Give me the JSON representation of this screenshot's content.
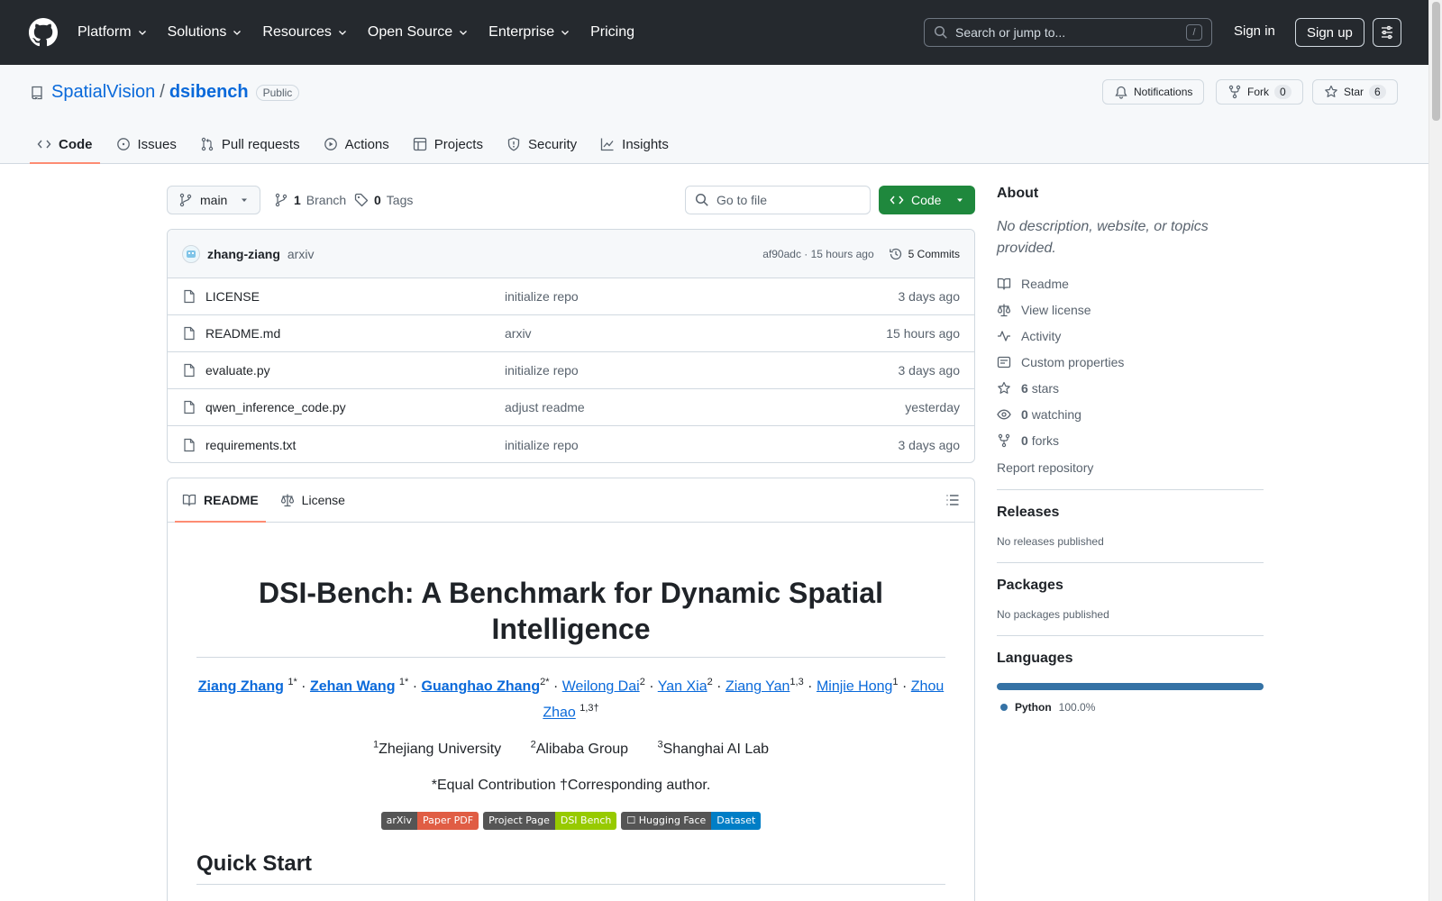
{
  "header": {
    "nav": [
      "Platform",
      "Solutions",
      "Resources",
      "Open Source",
      "Enterprise",
      "Pricing"
    ],
    "search_placeholder": "Search or jump to...",
    "search_key": "/",
    "sign_in": "Sign in",
    "sign_up": "Sign up"
  },
  "repo": {
    "owner": "SpatialVision",
    "separator": "/",
    "name": "dsibench",
    "visibility": "Public",
    "notifications": "Notifications",
    "fork": "Fork",
    "fork_count": "0",
    "star": "Star",
    "star_count": "6"
  },
  "tabs": [
    "Code",
    "Issues",
    "Pull requests",
    "Actions",
    "Projects",
    "Security",
    "Insights"
  ],
  "file_nav": {
    "branch": "main",
    "branch_count": "1",
    "branch_label": "Branch",
    "tag_count": "0",
    "tag_label": "Tags",
    "go_to_file": "Go to file",
    "code_button": "Code"
  },
  "latest_commit": {
    "author": "zhang-ziang",
    "message": "arxiv",
    "hash_time": "af90adc · 15 hours ago",
    "commits": "5 Commits"
  },
  "files": [
    {
      "name": "LICENSE",
      "message": "initialize repo",
      "date": "3 days ago"
    },
    {
      "name": "README.md",
      "message": "arxiv",
      "date": "15 hours ago"
    },
    {
      "name": "evaluate.py",
      "message": "initialize repo",
      "date": "3 days ago"
    },
    {
      "name": "qwen_inference_code.py",
      "message": "adjust readme",
      "date": "yesterday"
    },
    {
      "name": "requirements.txt",
      "message": "initialize repo",
      "date": "3 days ago"
    }
  ],
  "readme": {
    "tabs": [
      "README",
      "License"
    ],
    "title": "DSI-Bench: A Benchmark for Dynamic Spatial Intelligence",
    "authors": [
      {
        "name": "Ziang Zhang",
        "sup": "1*",
        "bold": true
      },
      {
        "name": "Zehan Wang",
        "sup": "1*",
        "bold": true
      },
      {
        "name": "Guanghao Zhang",
        "sup": "2*",
        "bold": true
      },
      {
        "name": "Weilong Dai",
        "sup": "2",
        "bold": false
      },
      {
        "name": "Yan Xia",
        "sup": "2",
        "bold": false
      },
      {
        "name": "Ziang Yan",
        "sup": "1,3",
        "bold": false
      },
      {
        "name": "Minjie Hong",
        "sup": "1",
        "bold": false
      },
      {
        "name": "Zhou Zhao",
        "sup": "1,3†",
        "bold": false
      }
    ],
    "affiliations": [
      {
        "sup": "1",
        "name": "Zhejiang University"
      },
      {
        "sup": "2",
        "name": "Alibaba Group"
      },
      {
        "sup": "3",
        "name": "Shanghai AI Lab"
      }
    ],
    "note": "*Equal Contribution †Corresponding author.",
    "badges": [
      {
        "left": "arXiv",
        "right": "Paper PDF",
        "color": "#e05d44"
      },
      {
        "left": "Project Page",
        "right": "DSI Bench",
        "color": "#97ca00"
      },
      {
        "left": "☐ Hugging Face",
        "right": "Dataset",
        "color": "#007ec6"
      }
    ],
    "section": "Quick Start"
  },
  "about": {
    "title": "About",
    "description": "No description, website, or topics provided.",
    "links": [
      {
        "icon": "book-icon",
        "count": "",
        "label": "Readme"
      },
      {
        "icon": "law-icon",
        "count": "",
        "label": "View license"
      },
      {
        "icon": "pulse-icon",
        "count": "",
        "label": "Activity"
      },
      {
        "icon": "note-icon",
        "count": "",
        "label": "Custom properties"
      },
      {
        "icon": "star-icon",
        "count": "6",
        "label": "stars"
      },
      {
        "icon": "eye-icon",
        "count": "0",
        "label": "watching"
      },
      {
        "icon": "fork-icon",
        "count": "0",
        "label": "forks"
      }
    ],
    "report": "Report repository"
  },
  "releases": {
    "title": "Releases",
    "text": "No releases published"
  },
  "packages": {
    "title": "Packages",
    "text": "No packages published"
  },
  "languages": {
    "title": "Languages",
    "items": [
      {
        "name": "Python",
        "percent": "100.0%",
        "color": "#3572A5"
      }
    ]
  }
}
